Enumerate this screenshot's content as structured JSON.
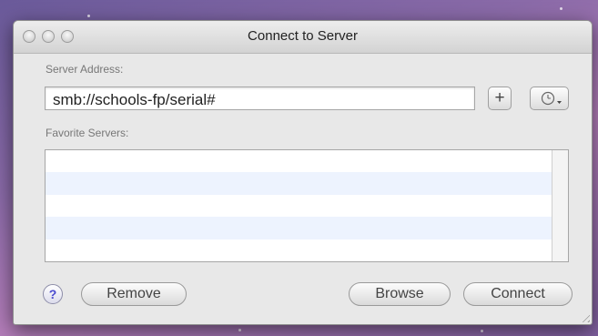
{
  "window": {
    "title": "Connect to Server"
  },
  "server_address": {
    "label": "Server Address:",
    "value": "smb://schools-fp/serial#"
  },
  "favorites": {
    "label": "Favorite Servers:",
    "items": []
  },
  "buttons": {
    "add": "+",
    "help": "?",
    "remove": "Remove",
    "browse": "Browse",
    "connect": "Connect"
  },
  "icons": {
    "add": "plus-icon",
    "recent": "clock-menu-icon",
    "help": "question-icon",
    "window_controls": [
      "close-icon",
      "minimize-icon",
      "zoom-icon"
    ]
  }
}
